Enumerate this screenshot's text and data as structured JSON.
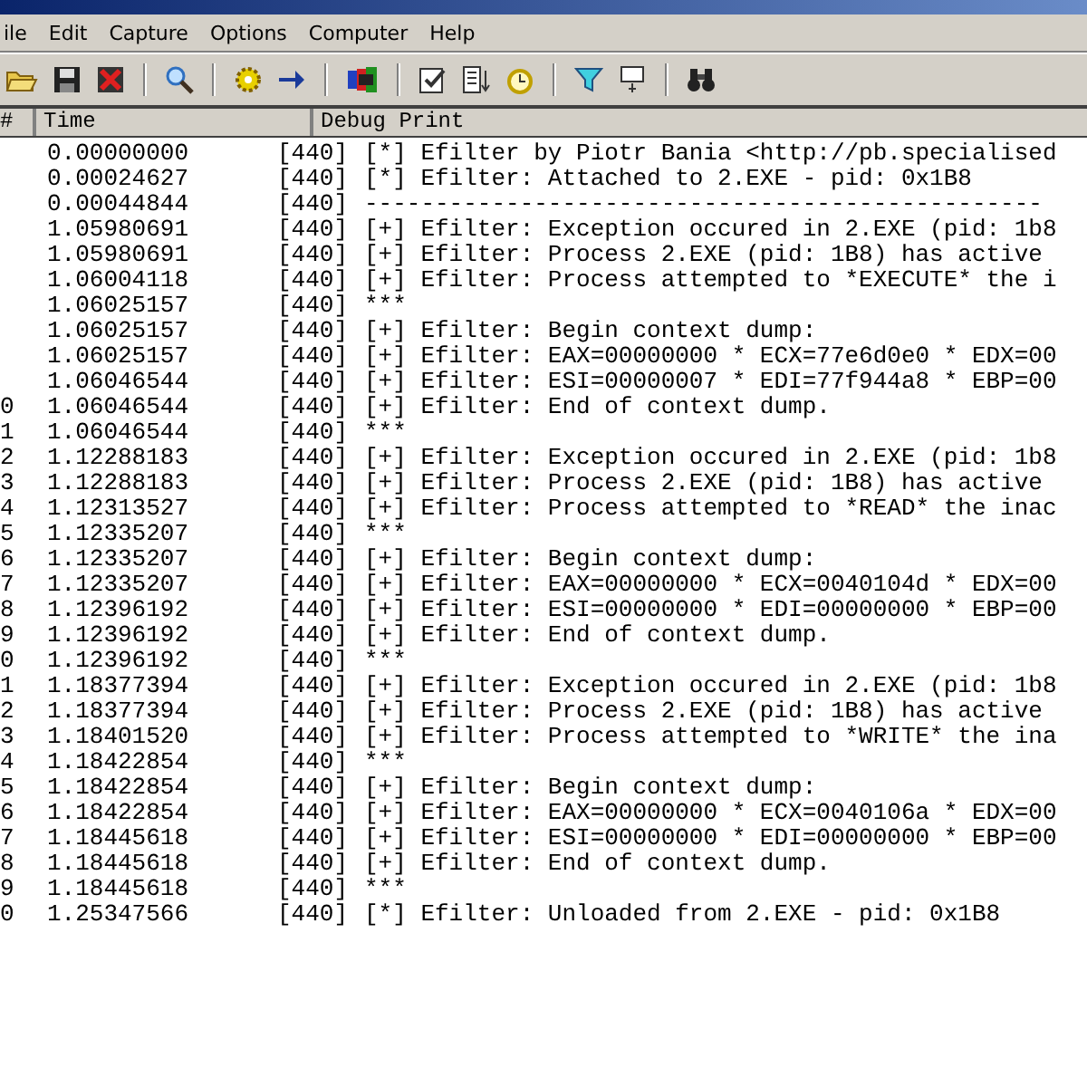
{
  "menu": [
    "ile",
    "Edit",
    "Capture",
    "Options",
    "Computer",
    "Help"
  ],
  "columns": [
    "#",
    "Time",
    "Debug Print"
  ],
  "rows": [
    {
      "num": "",
      "time": "0.00000000",
      "pid": "[440]",
      "text": "[*] Efilter by Piotr Bania <http://pb.specialised"
    },
    {
      "num": "",
      "time": "0.00024627",
      "pid": "[440]",
      "text": "[*] Efilter: Attached to 2.EXE - pid: 0x1B8"
    },
    {
      "num": "",
      "time": "0.00044844",
      "pid": "[440]",
      "text": "------------------------------------------------"
    },
    {
      "num": "",
      "time": "1.05980691",
      "pid": "[440]",
      "text": "[+] Efilter: Exception occured in 2.EXE (pid: 1b8"
    },
    {
      "num": "",
      "time": "1.05980691",
      "pid": "[440]",
      "text": "[+] Efilter: Process 2.EXE (pid: 1B8) has active"
    },
    {
      "num": "",
      "time": "1.06004118",
      "pid": "[440]",
      "text": "[+] Efilter: Process attempted to *EXECUTE* the i"
    },
    {
      "num": "",
      "time": "1.06025157",
      "pid": "[440]",
      "text": "***"
    },
    {
      "num": "",
      "time": "1.06025157",
      "pid": "[440]",
      "text": "[+] Efilter: Begin context dump:"
    },
    {
      "num": "",
      "time": "1.06025157",
      "pid": "[440]",
      "text": "[+] Efilter: EAX=00000000 * ECX=77e6d0e0 * EDX=00"
    },
    {
      "num": "",
      "time": "1.06046544",
      "pid": "[440]",
      "text": "[+] Efilter: ESI=00000007 * EDI=77f944a8 * EBP=00"
    },
    {
      "num": "0",
      "time": "1.06046544",
      "pid": "[440]",
      "text": "[+] Efilter: End of context dump."
    },
    {
      "num": "1",
      "time": "1.06046544",
      "pid": "[440]",
      "text": "***"
    },
    {
      "num": "2",
      "time": "1.12288183",
      "pid": "[440]",
      "text": "[+] Efilter: Exception occured in 2.EXE (pid: 1b8"
    },
    {
      "num": "3",
      "time": "1.12288183",
      "pid": "[440]",
      "text": "[+] Efilter: Process 2.EXE (pid: 1B8) has active"
    },
    {
      "num": "4",
      "time": "1.12313527",
      "pid": "[440]",
      "text": "[+] Efilter: Process attempted to *READ* the inac"
    },
    {
      "num": "5",
      "time": "1.12335207",
      "pid": "[440]",
      "text": "***"
    },
    {
      "num": "6",
      "time": "1.12335207",
      "pid": "[440]",
      "text": "[+] Efilter: Begin context dump:"
    },
    {
      "num": "7",
      "time": "1.12335207",
      "pid": "[440]",
      "text": "[+] Efilter: EAX=00000000 * ECX=0040104d * EDX=00"
    },
    {
      "num": "8",
      "time": "1.12396192",
      "pid": "[440]",
      "text": "[+] Efilter: ESI=00000000 * EDI=00000000 * EBP=00"
    },
    {
      "num": "9",
      "time": "1.12396192",
      "pid": "[440]",
      "text": "[+] Efilter: End of context dump."
    },
    {
      "num": "0",
      "time": "1.12396192",
      "pid": "[440]",
      "text": "***"
    },
    {
      "num": "1",
      "time": "1.18377394",
      "pid": "[440]",
      "text": "[+] Efilter: Exception occured in 2.EXE (pid: 1b8"
    },
    {
      "num": "2",
      "time": "1.18377394",
      "pid": "[440]",
      "text": "[+] Efilter: Process 2.EXE (pid: 1B8) has active"
    },
    {
      "num": "3",
      "time": "1.18401520",
      "pid": "[440]",
      "text": "[+] Efilter: Process attempted to *WRITE* the ina"
    },
    {
      "num": "4",
      "time": "1.18422854",
      "pid": "[440]",
      "text": "***"
    },
    {
      "num": "5",
      "time": "1.18422854",
      "pid": "[440]",
      "text": "[+] Efilter: Begin context dump:"
    },
    {
      "num": "6",
      "time": "1.18422854",
      "pid": "[440]",
      "text": "[+] Efilter: EAX=00000000 * ECX=0040106a * EDX=00"
    },
    {
      "num": "7",
      "time": "1.18445618",
      "pid": "[440]",
      "text": "[+] Efilter: ESI=00000000 * EDI=00000000 * EBP=00"
    },
    {
      "num": "8",
      "time": "1.18445618",
      "pid": "[440]",
      "text": "[+] Efilter: End of context dump."
    },
    {
      "num": "9",
      "time": "1.18445618",
      "pid": "[440]",
      "text": "***"
    },
    {
      "num": "0",
      "time": "1.25347566",
      "pid": "[440]",
      "text": "[*] Efilter: Unloaded from 2.EXE - pid: 0x1B8"
    }
  ]
}
